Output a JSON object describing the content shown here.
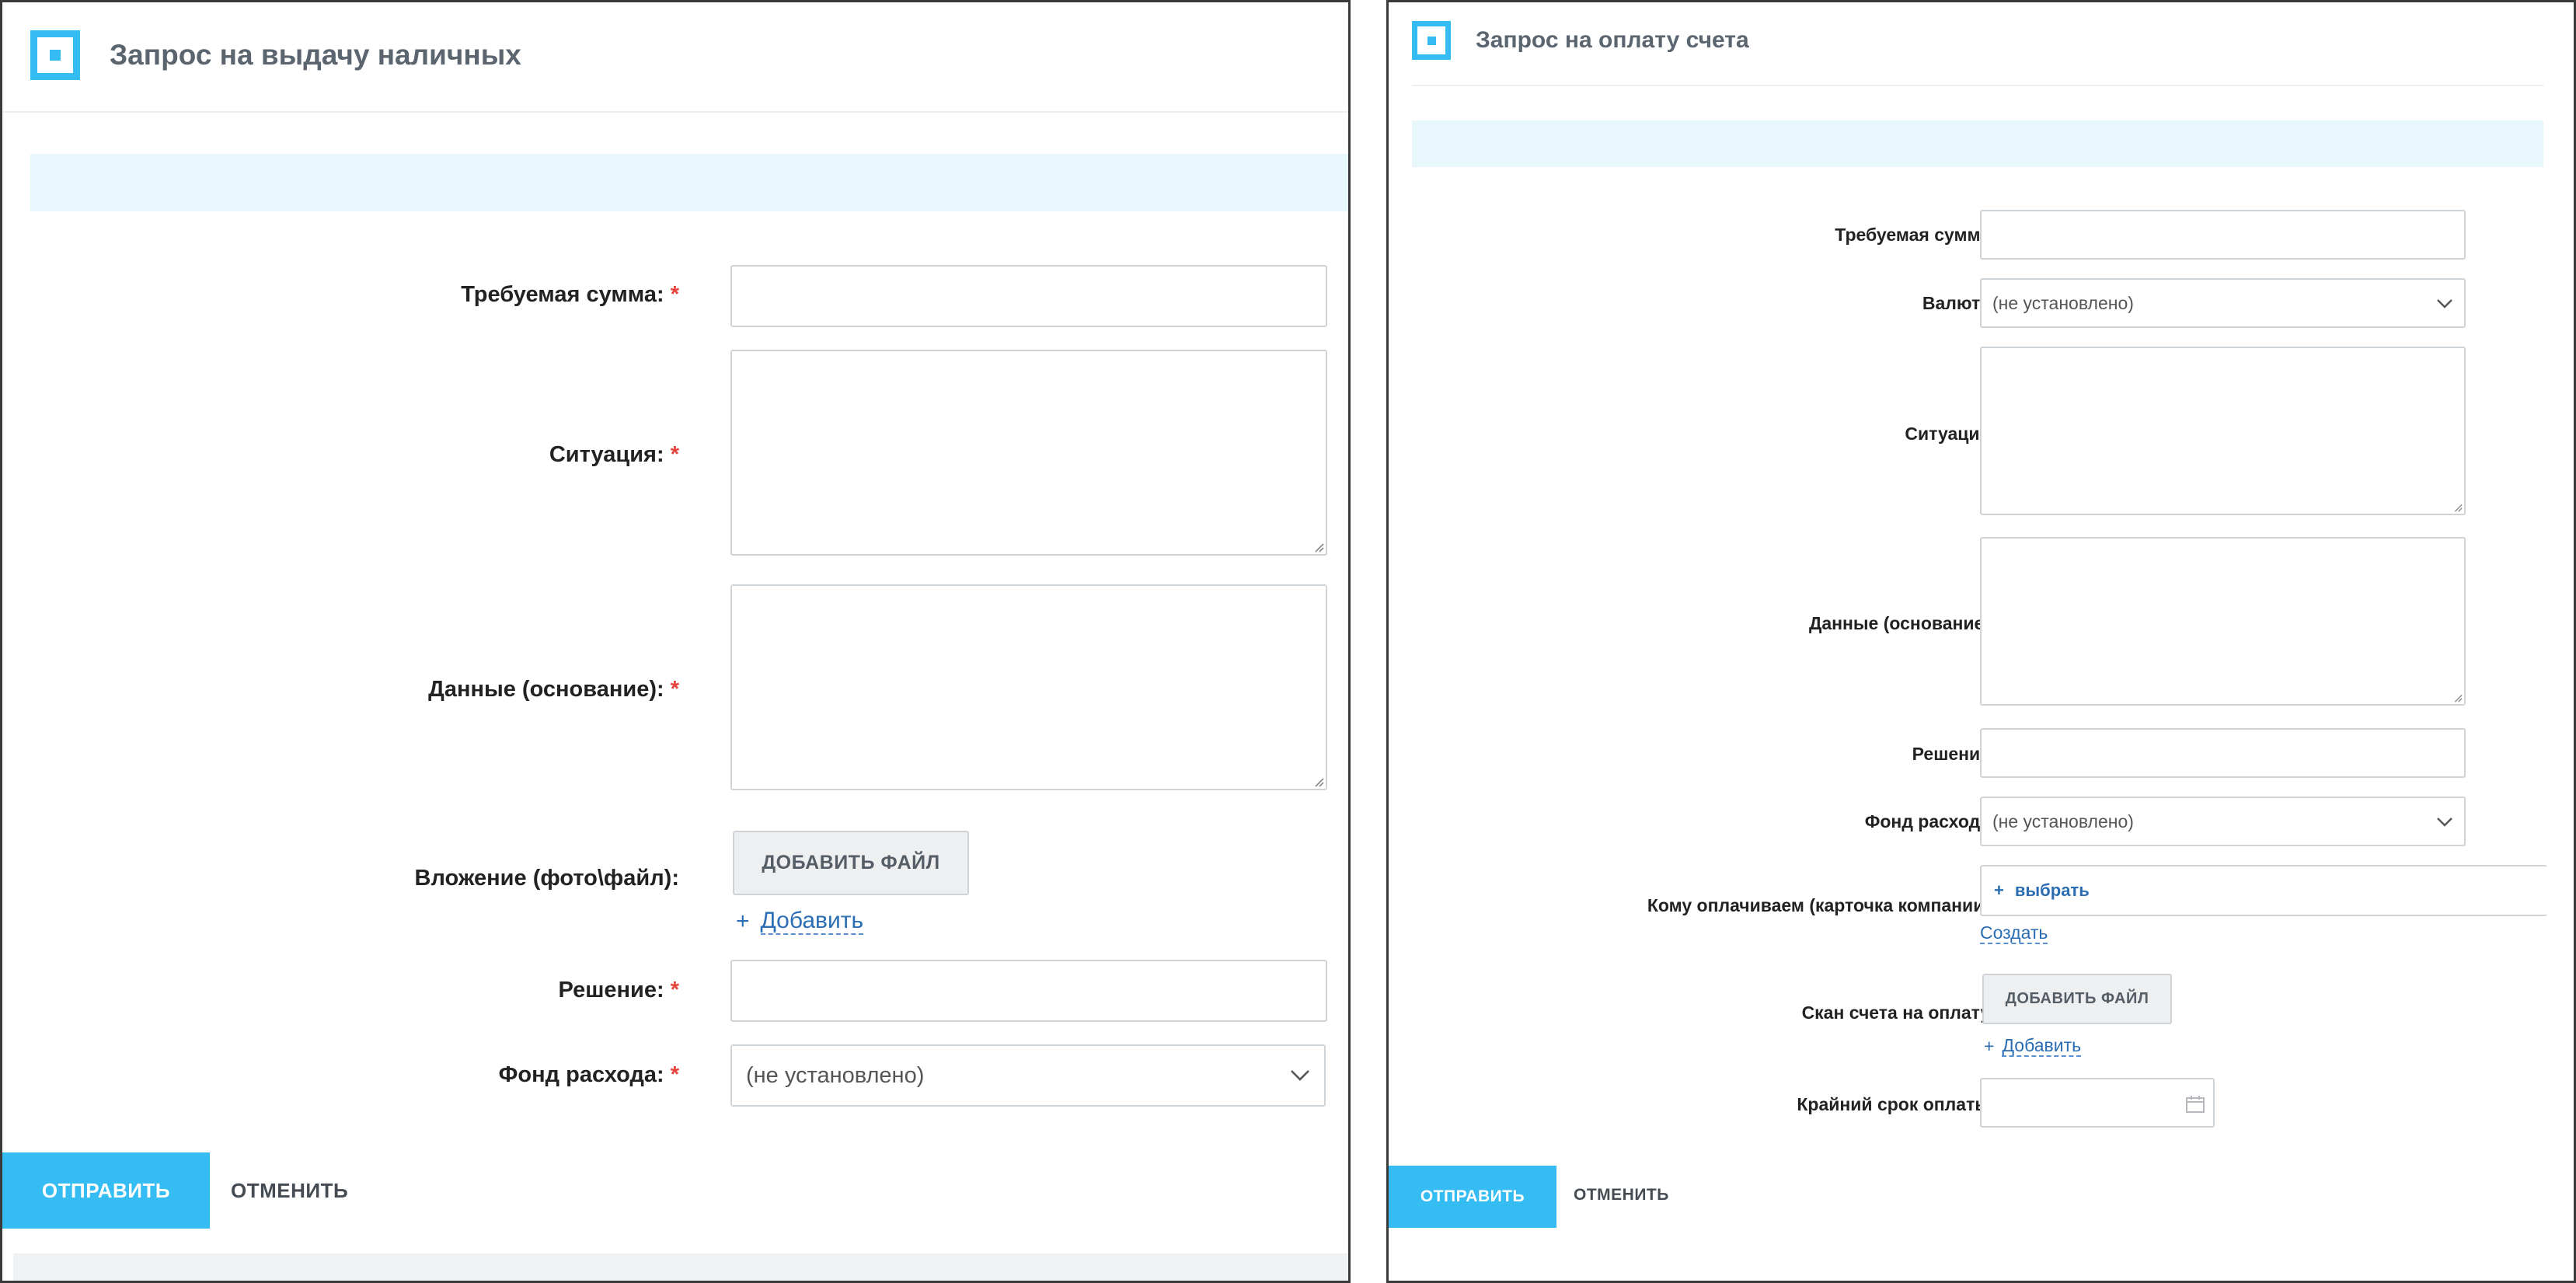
{
  "cash_request": {
    "title": "Запрос на выдачу наличных",
    "required_mark": "*",
    "fields": {
      "amount_label": "Требуемая сумма:",
      "situation_label": "Ситуация:",
      "basis_label": "Данные (основание):",
      "attachment_label": "Вложение (фото\\файл):",
      "decision_label": "Решение:",
      "fund_label": "Фонд расхода:"
    },
    "add_file_button": "ДОБАВИТЬ ФАЙЛ",
    "add_link": "Добавить",
    "add_plus": "+",
    "fund_value": "(не установлено)",
    "submit": "ОТПРАВИТЬ",
    "cancel": "ОТМЕНИТЬ"
  },
  "invoice_request": {
    "title": "Запрос на оплату счета",
    "required_mark": "*",
    "fields": {
      "amount_label": "Требуемая сумма:",
      "currency_label": "Валюта:",
      "situation_label": "Ситуация:",
      "basis_label": "Данные (основание):",
      "decision_label": "Решение:",
      "fund_label": "Фонд расхода:",
      "payee_label": "Кому оплачиваем (карточка компании):",
      "scan_label": "Скан счета на оплату:",
      "deadline_label": "Крайний срок оплаты:"
    },
    "currency_value": "(не установлено)",
    "fund_value": "(не установлено)",
    "select_plus": "+",
    "select_link": "выбрать",
    "create_link": "Создать",
    "add_file_button": "ДОБАВИТЬ ФАЙЛ",
    "add_link": "Добавить",
    "add_plus": "+",
    "submit": "ОТПРАВИТЬ",
    "cancel": "ОТМЕНИТЬ"
  },
  "colors": {
    "accent": "#35bdf3",
    "required": "#e8423d",
    "link": "#2a6db3",
    "band": "#e7f7fc"
  },
  "icons": [
    "app-logo-icon",
    "chevron-down-icon",
    "resize-grip-icon",
    "calendar-icon"
  ]
}
